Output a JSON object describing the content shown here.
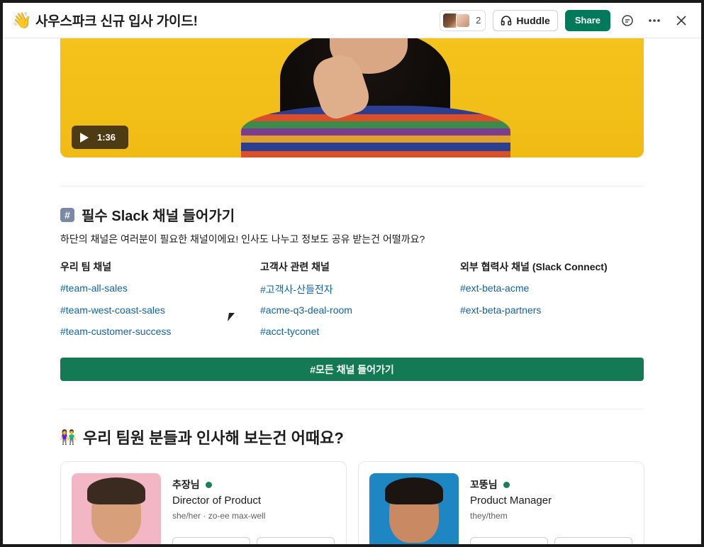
{
  "header": {
    "emoji": "👋",
    "title": "사우스파크 신규 입사 가이드!",
    "member_count": "2",
    "huddle_label": "Huddle",
    "share_label": "Share"
  },
  "video": {
    "duration": "1:36"
  },
  "channels_section": {
    "title": "필수 Slack 채널 들어가기",
    "description": "하단의 채널은 여러분이 필요한 채널이에요! 인사도 나누고 정보도 공유 받는건 어떨까요?",
    "columns": [
      {
        "heading": "우리 팀 채널",
        "links": [
          "#team-all-sales",
          "#team-west-coast-sales",
          "#team-customer-success"
        ]
      },
      {
        "heading": "고객사 관련 채널",
        "links": [
          "#고객사-산들전자",
          "#acme-q3-deal-room",
          "#acct-tyconet"
        ]
      },
      {
        "heading": "외부 협력사 채널 (Slack Connect)",
        "links": [
          "#ext-beta-acme",
          "#ext-beta-partners"
        ]
      }
    ],
    "cta_label": "#모든 채널 들어가기"
  },
  "team_section": {
    "title": "우리 팀원 분들과 인사해 보는건 어때요?",
    "members": [
      {
        "name": "추장님",
        "role": "Director of Product",
        "pronouns": "she/her · zo-ee max-well",
        "status_color": "#1a7f5a"
      },
      {
        "name": "꼬뚱님",
        "role": "Product Manager",
        "pronouns": "they/them",
        "status_color": "#1a7f5a"
      }
    ]
  },
  "colors": {
    "accent_green": "#007a5a",
    "link_blue": "#1264a3",
    "hero_yellow": "#f4c31c"
  }
}
